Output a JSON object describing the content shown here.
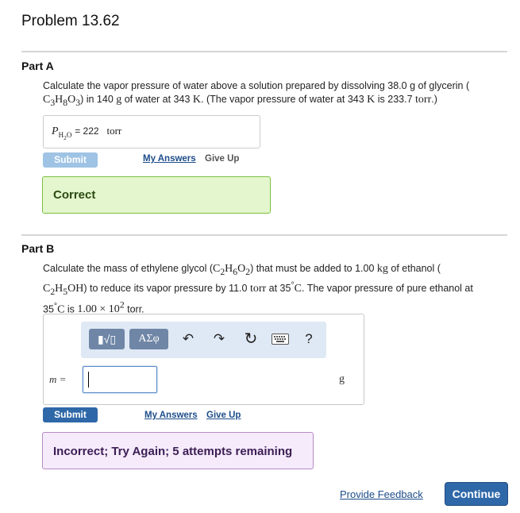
{
  "title": "Problem 13.62",
  "part_a": {
    "heading": "Part A",
    "question_pre": "Calculate the vapor pressure of water above a solution prepared by dissolving 38.0 g of glycerin (",
    "formula": "C3H8O3",
    "question_mid": ") in 140 g of water at 343 K. (The vapor pressure of water at 343 K is 233.7 torr.)",
    "answer_label": "P",
    "answer_subscript": "H2O",
    "answer_value": "222",
    "answer_unit": "torr",
    "submit": "Submit",
    "my_answers": "My Answers",
    "give_up": "Give Up",
    "result": "Correct"
  },
  "part_b": {
    "heading": "Part B",
    "question_pre": "Calculate the mass of ethylene glycol (",
    "formula1": "C2H6O2",
    "question_mid1": ") that must be added to 1.00 kg of ethanol (",
    "formula2": "C2H5OH",
    "question_mid2": ") to reduce its vapor pressure by 11.0 torr at 35 °C. The vapor pressure of pure ethanol at",
    "question_line3": "35 °C is 1.00 × 10² torr.",
    "toolbar": {
      "templates": "▮√▯",
      "greek": "ΑΣφ",
      "undo": "undo-icon",
      "redo": "redo-icon",
      "reset": "reset-icon",
      "keyboard": "keyboard-icon",
      "help": "?"
    },
    "input_label": "m =",
    "input_value": "",
    "unit": "g",
    "submit": "Submit",
    "my_answers": "My Answers",
    "give_up": "Give Up",
    "result": "Incorrect; Try Again; 5 attempts remaining"
  },
  "footer": {
    "feedback": "Provide Feedback",
    "continue": "Continue"
  },
  "colors": {
    "submit_disabled": "#9fc3e4",
    "submit_active": "#2f68a8",
    "correct_bg": "#e4f6cd",
    "incorrect_bg": "#f5ebfa"
  }
}
